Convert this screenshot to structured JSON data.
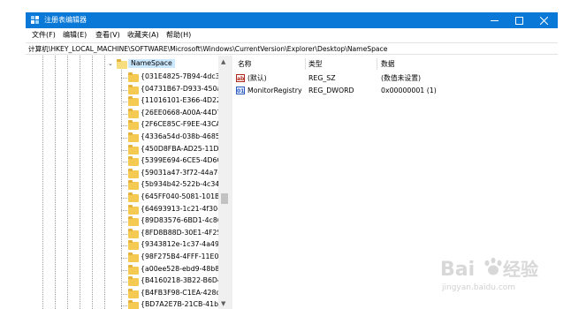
{
  "window": {
    "title": "注册表编辑器",
    "titlebar_color": "#0a78d7"
  },
  "menu": [
    "文件(F)",
    "编辑(E)",
    "查看(V)",
    "收藏夹(A)",
    "帮助(H)"
  ],
  "address": {
    "path": "计算机\\HKEY_LOCAL_MACHINE\\SOFTWARE\\Microsoft\\Windows\\CurrentVersion\\Explorer\\Desktop\\NameSpace"
  },
  "tree": {
    "selected": "NameSpace",
    "children": [
      "{031E4825-7B94-4dc3-",
      "{04731B67-D933-450a",
      "{11016101-E366-4D22-",
      "{26EE0668-A00A-44D7",
      "{2F6CE85C-F9EE-43CA-",
      "{4336a54d-038b-4685-",
      "{450D8FBA-AD25-11D0",
      "{5399E694-6CE5-4D6C",
      "{59031a47-3f72-44a7-",
      "{5b934b42-522b-4c34-",
      "{645FF040-5081-101B-",
      "{64693913-1c21-4f30-a",
      "{89D83576-6BD1-4c86",
      "{8FD8B88D-30E1-4F25",
      "{9343812e-1c37-4a49-",
      "{98F275B4-4FFF-11E0-",
      "{a00ee528-ebd9-48b8",
      "{B4160218-3B22-B6D4",
      "{B4FB3F98-C1EA-428d",
      "{BD7A2E7B-21CB-41b2"
    ]
  },
  "values": {
    "headers": {
      "name": "名称",
      "type": "类型",
      "data": "数据"
    },
    "rows": [
      {
        "icon": "string-value-icon",
        "name": "(默认)",
        "type": "REG_SZ",
        "data": "(数值未设置)"
      },
      {
        "icon": "dword-value-icon",
        "name": "MonitorRegistry",
        "type": "REG_DWORD",
        "data": "0x00000001 (1)"
      }
    ]
  },
  "watermark": {
    "logo": "Baidu 经验",
    "url": "jingyan.baidu.com"
  }
}
